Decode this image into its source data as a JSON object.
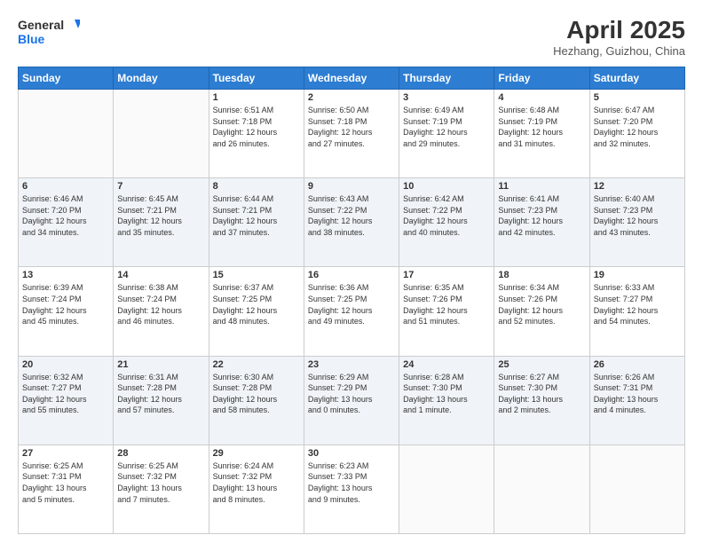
{
  "header": {
    "logo_line1": "General",
    "logo_line2": "Blue",
    "title": "April 2025",
    "subtitle": "Hezhang, Guizhou, China"
  },
  "calendar": {
    "days_of_week": [
      "Sunday",
      "Monday",
      "Tuesday",
      "Wednesday",
      "Thursday",
      "Friday",
      "Saturday"
    ],
    "weeks": [
      [
        {
          "day": "",
          "info": ""
        },
        {
          "day": "",
          "info": ""
        },
        {
          "day": "1",
          "info": "Sunrise: 6:51 AM\nSunset: 7:18 PM\nDaylight: 12 hours\nand 26 minutes."
        },
        {
          "day": "2",
          "info": "Sunrise: 6:50 AM\nSunset: 7:18 PM\nDaylight: 12 hours\nand 27 minutes."
        },
        {
          "day": "3",
          "info": "Sunrise: 6:49 AM\nSunset: 7:19 PM\nDaylight: 12 hours\nand 29 minutes."
        },
        {
          "day": "4",
          "info": "Sunrise: 6:48 AM\nSunset: 7:19 PM\nDaylight: 12 hours\nand 31 minutes."
        },
        {
          "day": "5",
          "info": "Sunrise: 6:47 AM\nSunset: 7:20 PM\nDaylight: 12 hours\nand 32 minutes."
        }
      ],
      [
        {
          "day": "6",
          "info": "Sunrise: 6:46 AM\nSunset: 7:20 PM\nDaylight: 12 hours\nand 34 minutes."
        },
        {
          "day": "7",
          "info": "Sunrise: 6:45 AM\nSunset: 7:21 PM\nDaylight: 12 hours\nand 35 minutes."
        },
        {
          "day": "8",
          "info": "Sunrise: 6:44 AM\nSunset: 7:21 PM\nDaylight: 12 hours\nand 37 minutes."
        },
        {
          "day": "9",
          "info": "Sunrise: 6:43 AM\nSunset: 7:22 PM\nDaylight: 12 hours\nand 38 minutes."
        },
        {
          "day": "10",
          "info": "Sunrise: 6:42 AM\nSunset: 7:22 PM\nDaylight: 12 hours\nand 40 minutes."
        },
        {
          "day": "11",
          "info": "Sunrise: 6:41 AM\nSunset: 7:23 PM\nDaylight: 12 hours\nand 42 minutes."
        },
        {
          "day": "12",
          "info": "Sunrise: 6:40 AM\nSunset: 7:23 PM\nDaylight: 12 hours\nand 43 minutes."
        }
      ],
      [
        {
          "day": "13",
          "info": "Sunrise: 6:39 AM\nSunset: 7:24 PM\nDaylight: 12 hours\nand 45 minutes."
        },
        {
          "day": "14",
          "info": "Sunrise: 6:38 AM\nSunset: 7:24 PM\nDaylight: 12 hours\nand 46 minutes."
        },
        {
          "day": "15",
          "info": "Sunrise: 6:37 AM\nSunset: 7:25 PM\nDaylight: 12 hours\nand 48 minutes."
        },
        {
          "day": "16",
          "info": "Sunrise: 6:36 AM\nSunset: 7:25 PM\nDaylight: 12 hours\nand 49 minutes."
        },
        {
          "day": "17",
          "info": "Sunrise: 6:35 AM\nSunset: 7:26 PM\nDaylight: 12 hours\nand 51 minutes."
        },
        {
          "day": "18",
          "info": "Sunrise: 6:34 AM\nSunset: 7:26 PM\nDaylight: 12 hours\nand 52 minutes."
        },
        {
          "day": "19",
          "info": "Sunrise: 6:33 AM\nSunset: 7:27 PM\nDaylight: 12 hours\nand 54 minutes."
        }
      ],
      [
        {
          "day": "20",
          "info": "Sunrise: 6:32 AM\nSunset: 7:27 PM\nDaylight: 12 hours\nand 55 minutes."
        },
        {
          "day": "21",
          "info": "Sunrise: 6:31 AM\nSunset: 7:28 PM\nDaylight: 12 hours\nand 57 minutes."
        },
        {
          "day": "22",
          "info": "Sunrise: 6:30 AM\nSunset: 7:28 PM\nDaylight: 12 hours\nand 58 minutes."
        },
        {
          "day": "23",
          "info": "Sunrise: 6:29 AM\nSunset: 7:29 PM\nDaylight: 13 hours\nand 0 minutes."
        },
        {
          "day": "24",
          "info": "Sunrise: 6:28 AM\nSunset: 7:30 PM\nDaylight: 13 hours\nand 1 minute."
        },
        {
          "day": "25",
          "info": "Sunrise: 6:27 AM\nSunset: 7:30 PM\nDaylight: 13 hours\nand 2 minutes."
        },
        {
          "day": "26",
          "info": "Sunrise: 6:26 AM\nSunset: 7:31 PM\nDaylight: 13 hours\nand 4 minutes."
        }
      ],
      [
        {
          "day": "27",
          "info": "Sunrise: 6:25 AM\nSunset: 7:31 PM\nDaylight: 13 hours\nand 5 minutes."
        },
        {
          "day": "28",
          "info": "Sunrise: 6:25 AM\nSunset: 7:32 PM\nDaylight: 13 hours\nand 7 minutes."
        },
        {
          "day": "29",
          "info": "Sunrise: 6:24 AM\nSunset: 7:32 PM\nDaylight: 13 hours\nand 8 minutes."
        },
        {
          "day": "30",
          "info": "Sunrise: 6:23 AM\nSunset: 7:33 PM\nDaylight: 13 hours\nand 9 minutes."
        },
        {
          "day": "",
          "info": ""
        },
        {
          "day": "",
          "info": ""
        },
        {
          "day": "",
          "info": ""
        }
      ]
    ]
  }
}
